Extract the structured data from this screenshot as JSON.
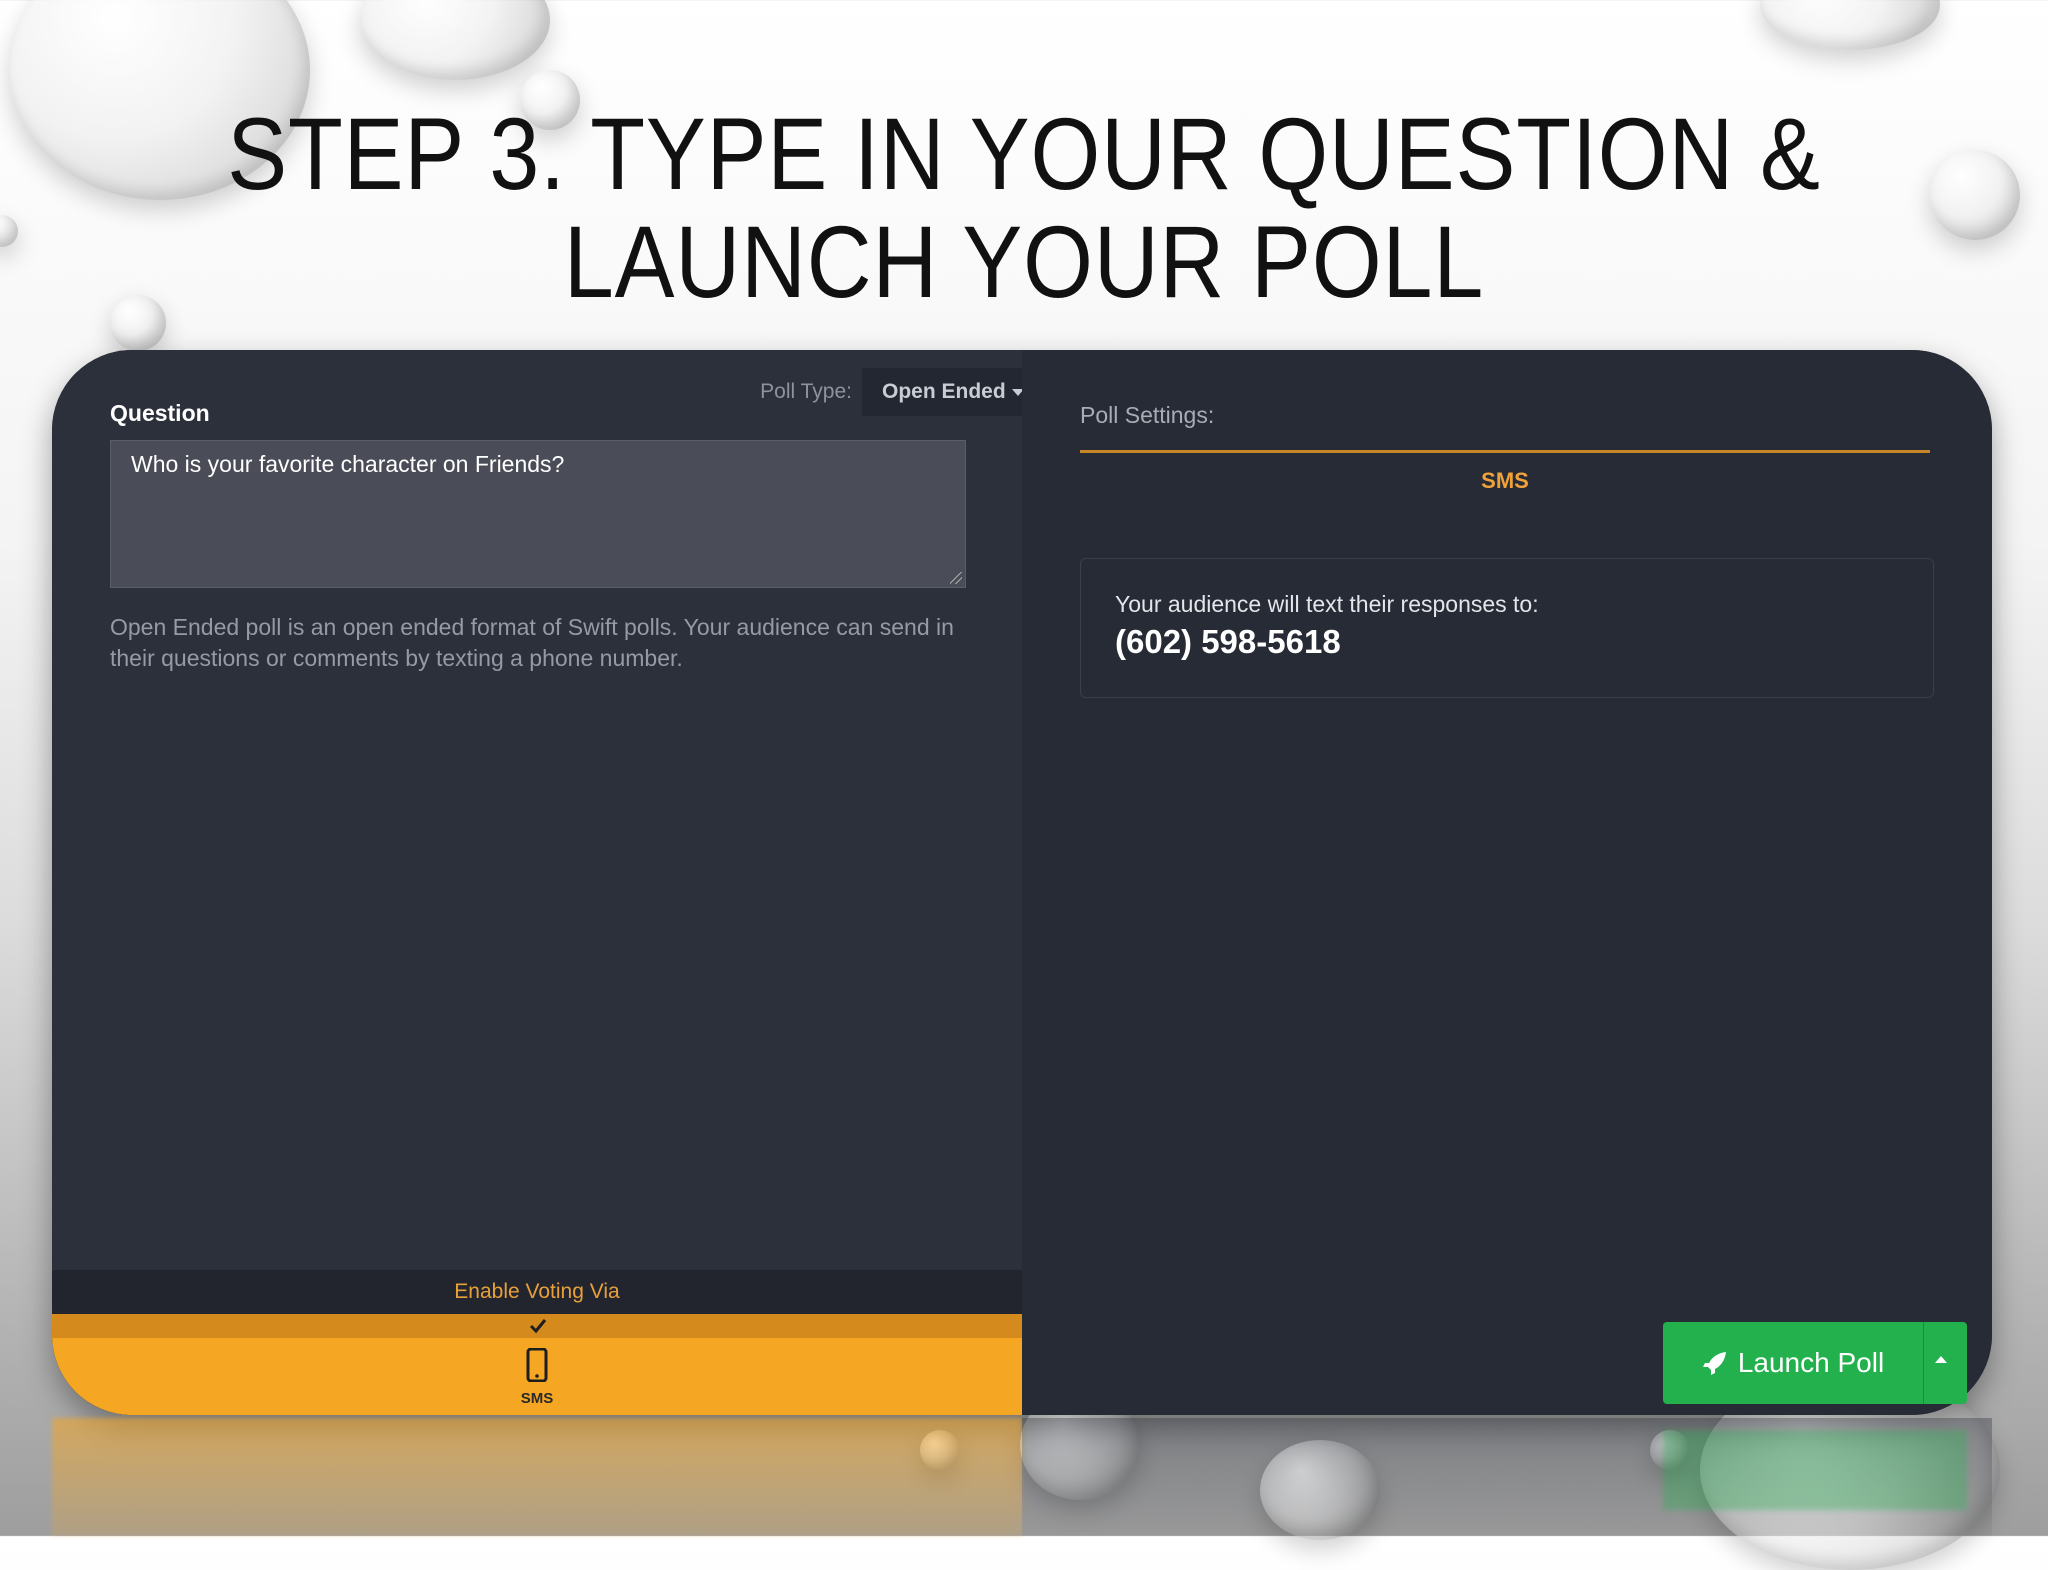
{
  "slide": {
    "title_line1": "STEP 3. TYPE IN YOUR QUESTION &",
    "title_line2": "LAUNCH YOUR POLL"
  },
  "poll_editor": {
    "poll_type_label": "Poll Type:",
    "poll_type_value": "Open Ended",
    "question_label": "Question",
    "question_value": "Who is your favorite character on Friends?",
    "help_text": "Open Ended poll is an open ended format of Swift polls. Your audience can send in their questions or comments by texting a phone number.",
    "enable_voting_label": "Enable Voting Via",
    "sms_option_label": "SMS"
  },
  "poll_settings": {
    "label": "Poll Settings:",
    "active_tab": "SMS",
    "sms_instructions": "Your audience will text their responses to:",
    "sms_number": "(602) 598-5618"
  },
  "launch": {
    "label": "Launch Poll"
  },
  "colors": {
    "accent_orange": "#f5a623",
    "launch_green": "#22b14c",
    "panel_dark": "#2b2f3a"
  },
  "icons": [
    "check-icon",
    "phone-icon",
    "rocket-icon",
    "caret-down-icon",
    "caret-up-icon"
  ]
}
